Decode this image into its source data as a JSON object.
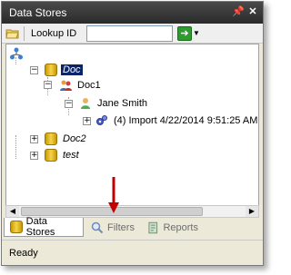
{
  "window": {
    "title": "Data Stores"
  },
  "toolbar": {
    "lookup_label": "Lookup ID",
    "lookup_value": ""
  },
  "tree": {
    "root": "",
    "nodes": [
      {
        "label": "Doc",
        "selected": true,
        "italic": true
      },
      {
        "label": "Doc1"
      },
      {
        "label": "Jane Smith"
      },
      {
        "label": "(4) Import 4/22/2014 9:51:25 AM"
      },
      {
        "label": "Doc2",
        "italic": true
      },
      {
        "label": "test",
        "italic": true
      }
    ]
  },
  "tabs": [
    {
      "label": "Data Stores",
      "active": true
    },
    {
      "label": "Filters",
      "active": false
    },
    {
      "label": "Reports",
      "active": false
    }
  ],
  "status": {
    "text": "Ready"
  },
  "colors": {
    "selection": "#0a246a",
    "annotation_arrow": "#c00000",
    "go_button": "#2e9b2e"
  }
}
